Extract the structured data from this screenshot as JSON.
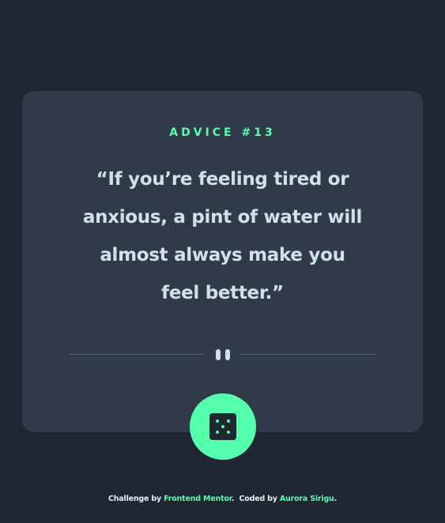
{
  "advice": {
    "number_label": "ADVICE #13",
    "quote": "“If you’re feeling tired or anxious, a pint of water will almost always make you feel better.”"
  },
  "divider": {
    "icon": "pause-icon"
  },
  "dice_button": {
    "icon": "dice-icon"
  },
  "attribution": {
    "challenge_prefix": "Challenge by",
    "challenge_link": "Frontend Mentor",
    "separator": ".",
    "coded_prefix": "Coded by",
    "coded_link": "Aurora Sirigu",
    "suffix": "."
  },
  "colors": {
    "background": "#202733",
    "card": "#313a48",
    "accent": "#53ffab",
    "text": "#cee3e9"
  }
}
